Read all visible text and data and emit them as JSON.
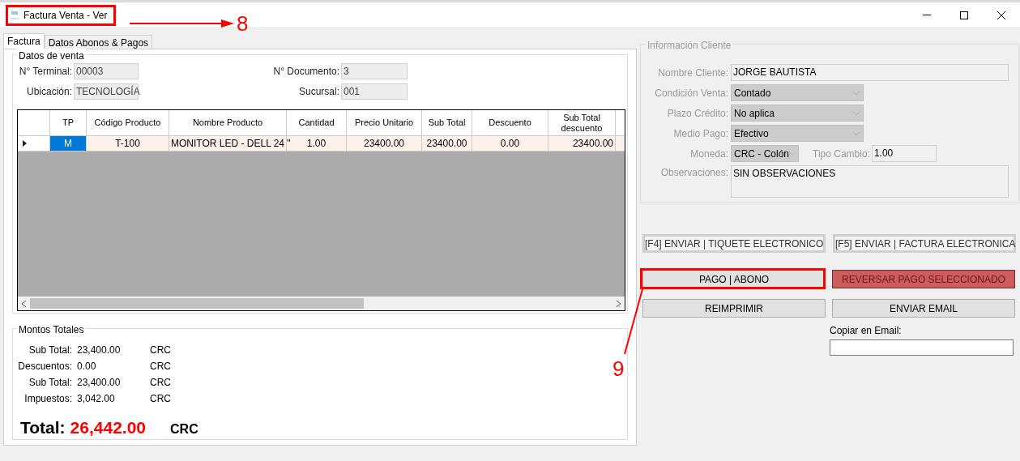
{
  "window": {
    "title": "Factura Venta - Ver"
  },
  "tabs": [
    {
      "label": "Factura",
      "selected": true
    },
    {
      "label": "Datos Abonos & Pagos",
      "selected": false
    }
  ],
  "sale_data": {
    "title": "Datos de venta",
    "fields": [
      {
        "label": "N° Terminal:",
        "value": "00003"
      },
      {
        "label": "N° Documento:",
        "value": "3"
      },
      {
        "label": "Ubicación:",
        "value": "TECNOLOGÍA"
      },
      {
        "label": "Sucursal:",
        "value": "001"
      }
    ]
  },
  "grid": {
    "columns": [
      "TP",
      "Código Producto",
      "Nombre Producto",
      "Cantidad",
      "Precio Unitario",
      "Sub Total",
      "Descuento",
      "Sub Total descuento"
    ],
    "rows": [
      {
        "current": true,
        "cells": [
          {
            "text": "M",
            "selected": true
          },
          {
            "text": "T-100",
            "selected": false
          },
          {
            "text": "MONITOR LED - DELL  24 \"",
            "selected": false
          },
          {
            "text": "1.00",
            "selected": false
          },
          {
            "text": "23400.00",
            "selected": false
          },
          {
            "text": "23400.00",
            "selected": false
          },
          {
            "text": "0.00",
            "selected": false
          },
          {
            "text": "23400.00",
            "selected": false
          }
        ]
      }
    ]
  },
  "totals": {
    "title": "Montos Totales",
    "lines": [
      {
        "label": "Sub Total:",
        "value": "23,400.00",
        "currency": "CRC"
      },
      {
        "label": "Descuentos:",
        "value": "0.00",
        "currency": "CRC"
      },
      {
        "label": "Sub Total:",
        "value": "23,400.00",
        "currency": "CRC"
      },
      {
        "label": "Impuestos:",
        "value": "3,042.00",
        "currency": "CRC"
      }
    ],
    "total": {
      "label": "Total:",
      "value": "26,442.00",
      "currency": "CRC"
    }
  },
  "client": {
    "title": "Información Cliente",
    "disabled": true,
    "fields": [
      {
        "kind": "text",
        "label": "Nombre Cliente:",
        "value": "JORGE BAUTISTA"
      },
      {
        "kind": "select",
        "label": "Condición Venta:",
        "value": "Contado"
      },
      {
        "kind": "select",
        "label": "Plazo Crédito:",
        "value": "No aplica"
      },
      {
        "kind": "select",
        "label": "Medio Pago:",
        "value": "Efectivo"
      },
      {
        "kind": "currency",
        "label": "Moneda:",
        "value": "CRC - Colón",
        "rate_label": "Tipo Cambio:",
        "rate": "1.00"
      },
      {
        "kind": "textarea",
        "label": "Observaciones:",
        "value": "SIN OBSERVACIONES"
      }
    ]
  },
  "buttons": [
    {
      "label": "[F4] ENVIAR | TIQUETE ELECTRONICO",
      "kind": "outline"
    },
    {
      "label": "[F5] ENVIAR | FACTURA ELECTRONICA",
      "kind": "outline"
    },
    {
      "label": "PAGO | ABONO",
      "kind": "normal"
    },
    {
      "label": "REVERSAR PAGO SELECCIONADO",
      "kind": "danger"
    },
    {
      "label": "REIMPRIMIR",
      "kind": "normal"
    },
    {
      "label": "ENVIAR EMAIL",
      "kind": "normal"
    }
  ],
  "email_copy": {
    "label": "Copiar en Email:"
  },
  "annotations": [
    {
      "label": "8"
    },
    {
      "label": "9"
    }
  ]
}
